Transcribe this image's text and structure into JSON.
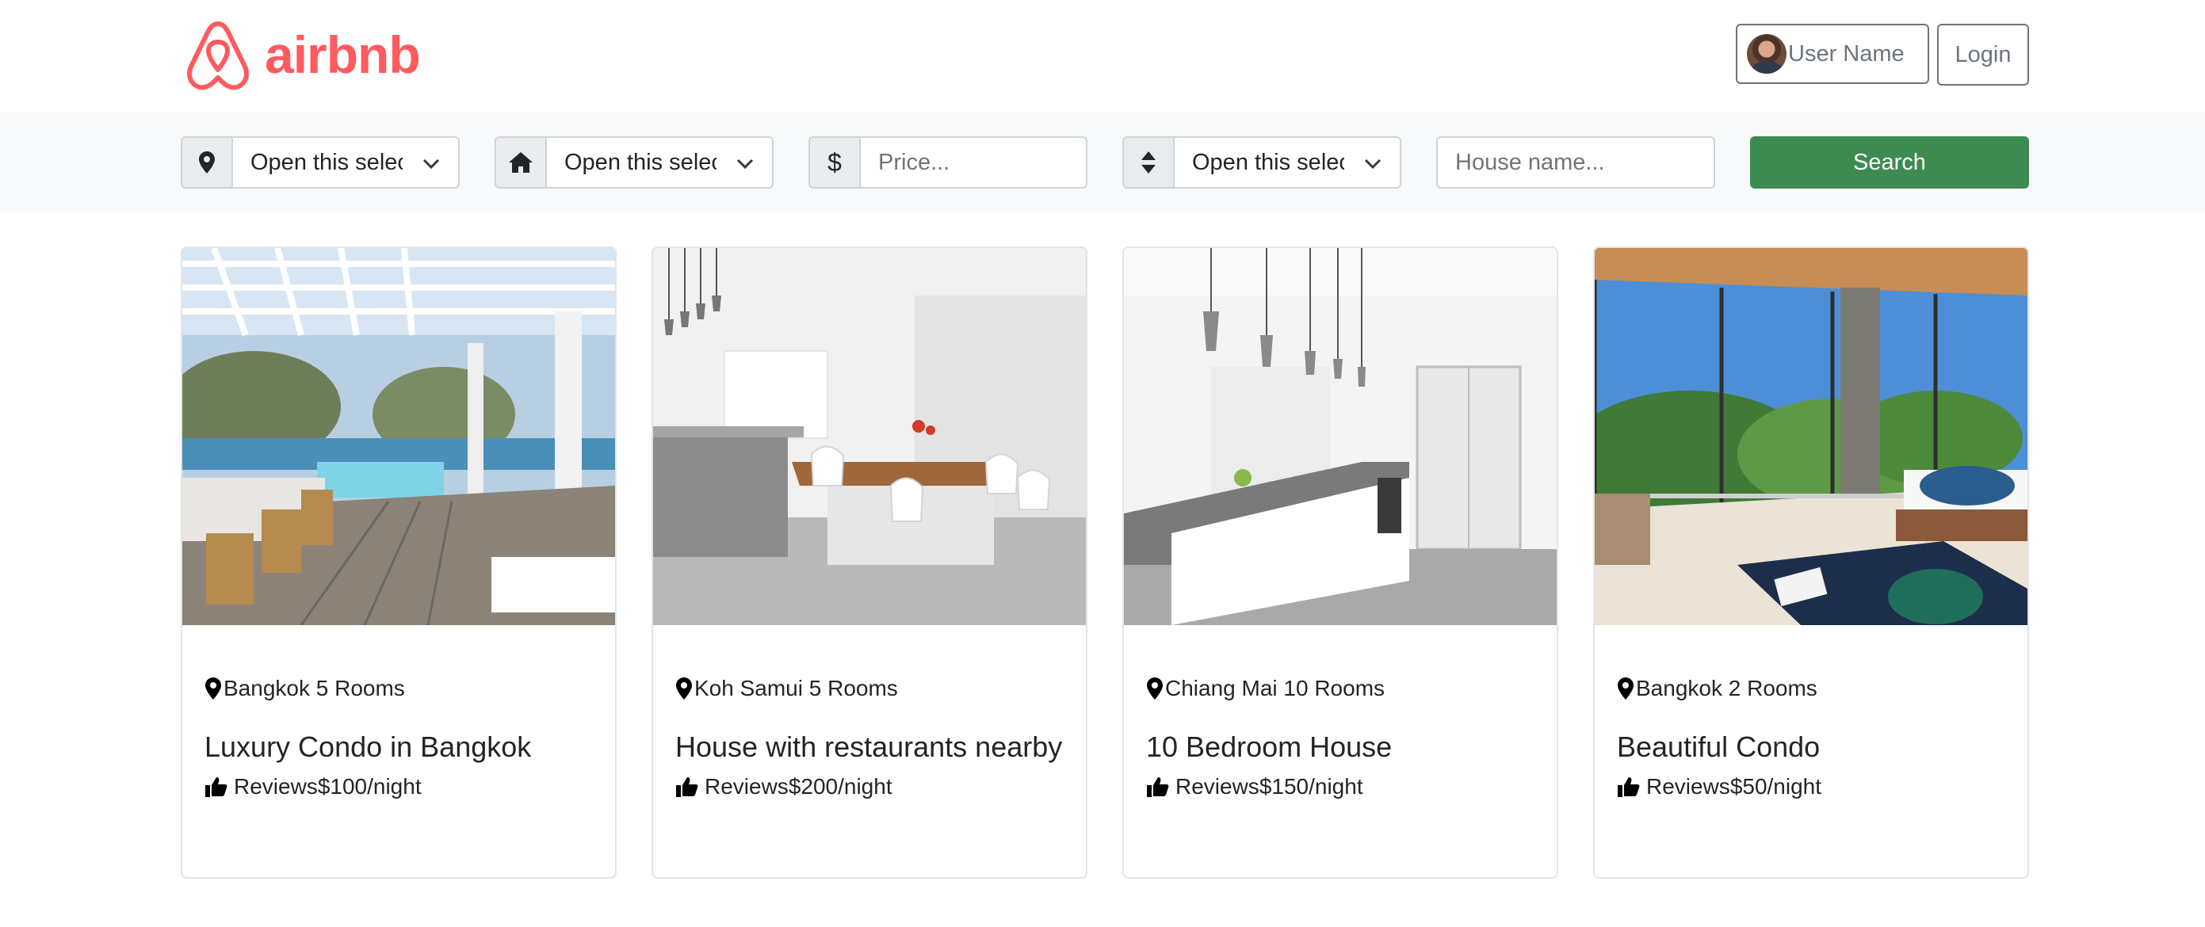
{
  "brand": {
    "name": "airbnb",
    "color": "#ff5a5f"
  },
  "header": {
    "user_name": "User Name",
    "login_label": "Login"
  },
  "filters": {
    "location": {
      "icon": "map-pin-icon",
      "value": "Open this select menu"
    },
    "house_type": {
      "icon": "home-icon",
      "value": "Open this select menu"
    },
    "price": {
      "icon": "dollar-icon",
      "addon_text": "$",
      "placeholder": "Price..."
    },
    "sort": {
      "icon": "sort-icon",
      "value": "Open this select menu"
    },
    "house_name": {
      "placeholder": "House name..."
    },
    "search_label": "Search",
    "search_color": "#3d8b50"
  },
  "listings": [
    {
      "location_rooms": "Bangkok 5 Rooms",
      "title": "Luxury Condo in Bangkok",
      "reviews": "Reviews",
      "price": "$100/night"
    },
    {
      "location_rooms": "Koh Samui 5 Rooms",
      "title": "House with restaurants nearby",
      "reviews": "Reviews",
      "price": "$200/night"
    },
    {
      "location_rooms": "Chiang Mai 10 Rooms",
      "title": "10 Bedroom House",
      "reviews": "Reviews",
      "price": "$150/night"
    },
    {
      "location_rooms": "Bangkok 2 Rooms",
      "title": "Beautiful Condo",
      "reviews": "Reviews",
      "price": "$50/night"
    }
  ]
}
